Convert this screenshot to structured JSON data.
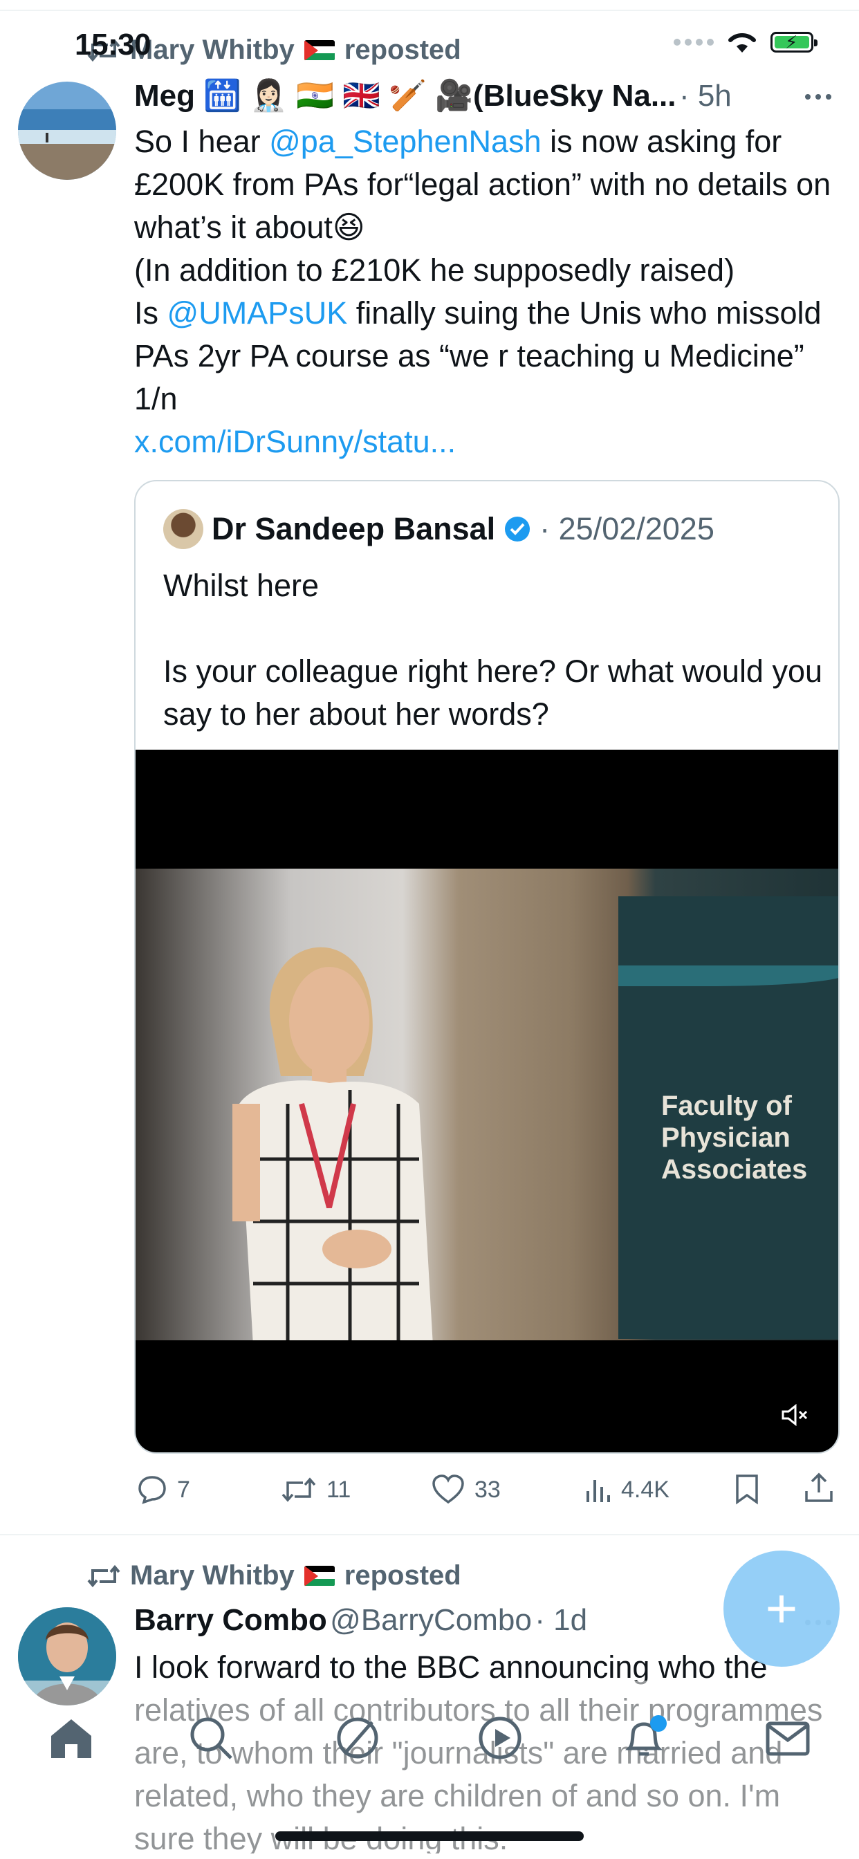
{
  "status_bar": {
    "time": "15:30"
  },
  "tweet1": {
    "repost_by": "Mary Whitby",
    "repost_label": "reposted",
    "author_name": "Meg 🛗 👩🏻‍⚕️ 🇮🇳 🇬🇧 🏏 🎥(BlueSky Na...",
    "time": "· 5h",
    "text_segments": [
      {
        "t": "So I hear "
      },
      {
        "t": "@pa_StephenNash",
        "link": true
      },
      {
        "t": " is now asking for £200K from PAs for“legal action” with no details on what’s it about😆\n(In addition to £210K he supposedly raised)\nIs "
      },
      {
        "t": "@UMAPsUK",
        "link": true
      },
      {
        "t": " finally suing the Unis who missold PAs 2yr PA course as “we r teaching u Medicine” 1/n\n"
      },
      {
        "t": "x.com/iDrSunny/statu...",
        "link": true
      }
    ],
    "quote": {
      "author_name": "Dr Sandeep Bansal",
      "date": "· 25/02/2025",
      "text_line1": "Whilst here",
      "text_line2": "Is your colleague right here? Or what would you say to her about her words?",
      "video_sign_line1": "Faculty of",
      "video_sign_line2": "Physician",
      "video_sign_line3": "Associates"
    },
    "actions": {
      "replies": "7",
      "reposts": "11",
      "likes": "33",
      "views": "4.4K"
    }
  },
  "tweet2": {
    "repost_by": "Mary Whitby",
    "repost_label": "reposted",
    "author_name": "Barry Combo",
    "handle": "@BarryCombo",
    "time": "· 1d",
    "text": "I look forward to the BBC announcing who the relatives of all contributors to all their programmes are, to whom their \"journalists\" are married and related, who they are children of and so on. I'm sure they will be doing this."
  },
  "fab_label": "+",
  "icons": [
    "repost-icon",
    "verified-badge-icon",
    "reply-icon",
    "like-icon",
    "views-icon",
    "bookmark-icon",
    "share-icon",
    "mute-icon",
    "home-icon",
    "search-icon",
    "grok-icon",
    "video-icon",
    "notifications-icon",
    "messages-icon"
  ]
}
